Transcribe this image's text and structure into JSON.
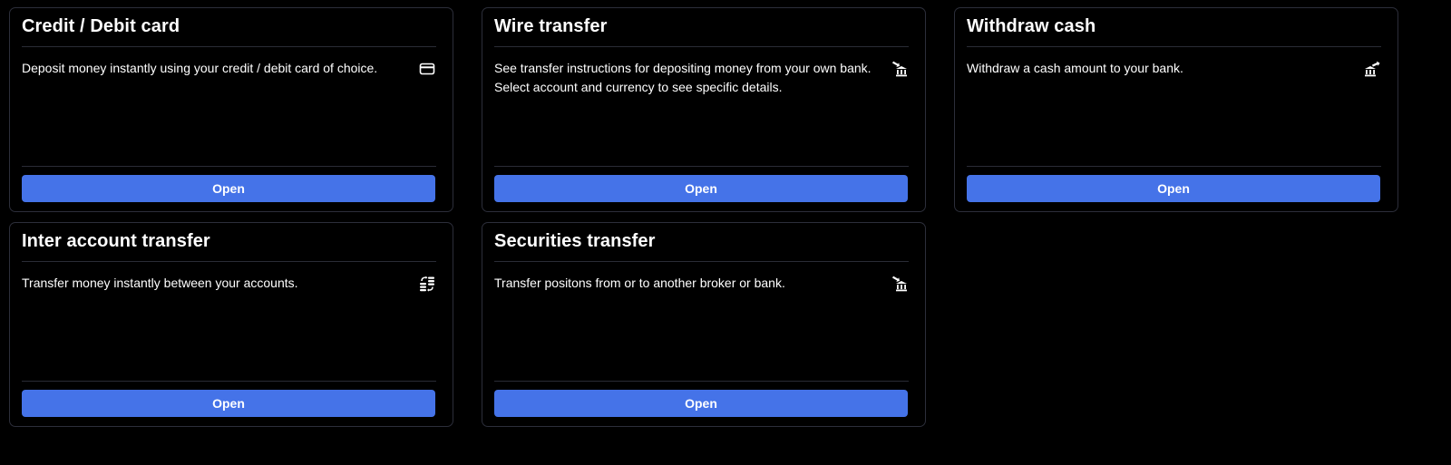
{
  "colors": {
    "background": "#000000",
    "card_border": "#2c2e3a",
    "divider": "#2a2c36",
    "button": "#4573e8",
    "text": "#ffffff"
  },
  "cards": [
    {
      "title": "Credit / Debit card",
      "description": "Deposit money instantly using your credit / debit card of choice.",
      "icon": "credit-card-icon",
      "button_label": "Open"
    },
    {
      "title": "Wire transfer",
      "description": "See transfer instructions for depositing money from your own bank. Select account and currency to see specific details.",
      "icon": "bank-deposit-icon",
      "button_label": "Open"
    },
    {
      "title": "Withdraw cash",
      "description": "Withdraw a cash amount to your bank.",
      "icon": "bank-withdraw-icon",
      "button_label": "Open"
    },
    {
      "title": "Inter account transfer",
      "description": "Transfer money instantly between your accounts.",
      "icon": "account-transfer-icon",
      "button_label": "Open"
    },
    {
      "title": "Securities transfer",
      "description": "Transfer positons from or to another broker or bank.",
      "icon": "bank-deposit-icon",
      "button_label": "Open"
    }
  ]
}
